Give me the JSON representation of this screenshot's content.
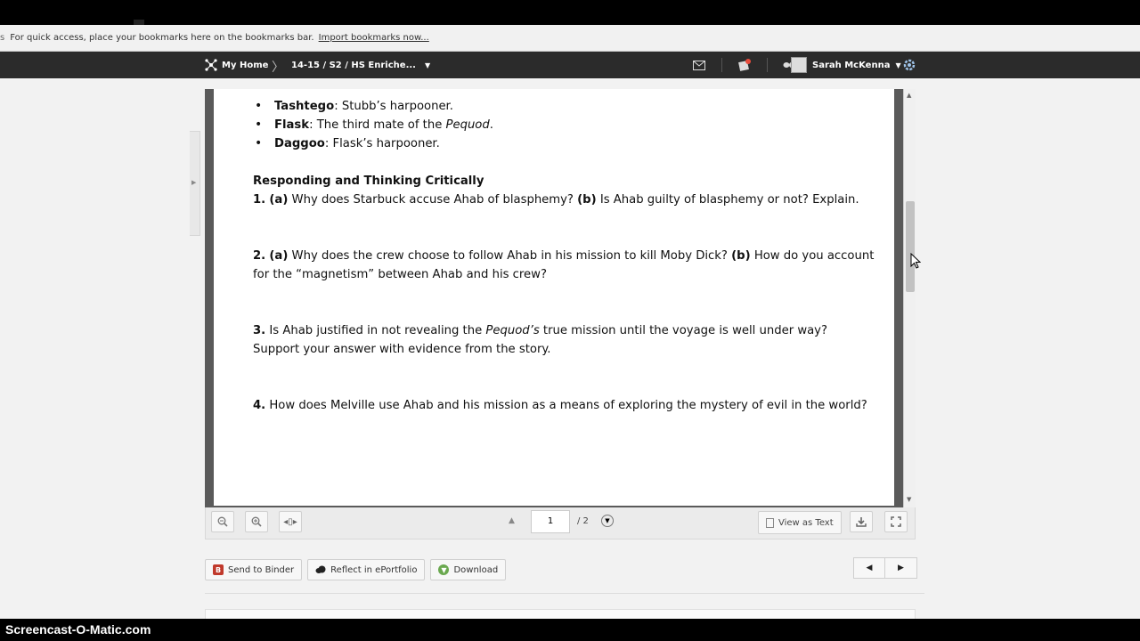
{
  "bookmarks_bar": {
    "edge_char": "s",
    "message": "For quick access, place your bookmarks here on the bookmarks bar.",
    "import_link": "Import bookmarks now..."
  },
  "nav": {
    "home_label": "My Home",
    "breadcrumb": "14-15 / S2 / HS Enriche...",
    "user_name": "Sarah McKenna"
  },
  "document": {
    "characters": [
      {
        "name": "Tashtego",
        "desc": ": Stubb’s harpooner."
      },
      {
        "name": "Flask",
        "desc_before": ": The third mate of the ",
        "desc_italic": "Pequod",
        "desc_after": "."
      },
      {
        "name": "Daggoo",
        "desc": ": Flask’s harpooner."
      }
    ],
    "section_heading": "Responding and Thinking Critically",
    "questions": [
      {
        "num": "1.",
        "a": "(a)",
        "a_text": " Why does Starbuck accuse Ahab of blasphemy? ",
        "b": "(b)",
        "b_text": " Is Ahab guilty of blasphemy or not? Explain."
      },
      {
        "num": "2.",
        "a": "(a)",
        "a_text": " Why does the crew choose to follow Ahab in his mission to kill Moby Dick? ",
        "b": "(b)",
        "b_text": " How do you account for the “magnetism” between Ahab and his crew?"
      },
      {
        "num": "3.",
        "text_before": " Is Ahab justified in not revealing the ",
        "italic": "Pequod’s",
        "text_after": " true mission until the voyage is well under way? Support your answer with evidence from the story."
      },
      {
        "num": "4.",
        "text": " How does Melville use Ahab and his mission as a means of exploring the mystery of evil in the world?"
      }
    ]
  },
  "viewer_toolbar": {
    "page_current": "1",
    "page_total": "/ 2",
    "view_as_text": "View as Text"
  },
  "actions": {
    "send_to_binder": "Send to Binder",
    "reflect": "Reflect in ePortfolio",
    "download": "Download"
  },
  "watermark": "Screencast-O-Matic.com",
  "colors": {
    "nav_bg": "#2b2b2b",
    "binder_icon": "#c0392b",
    "download_icon": "#6aa84f"
  }
}
